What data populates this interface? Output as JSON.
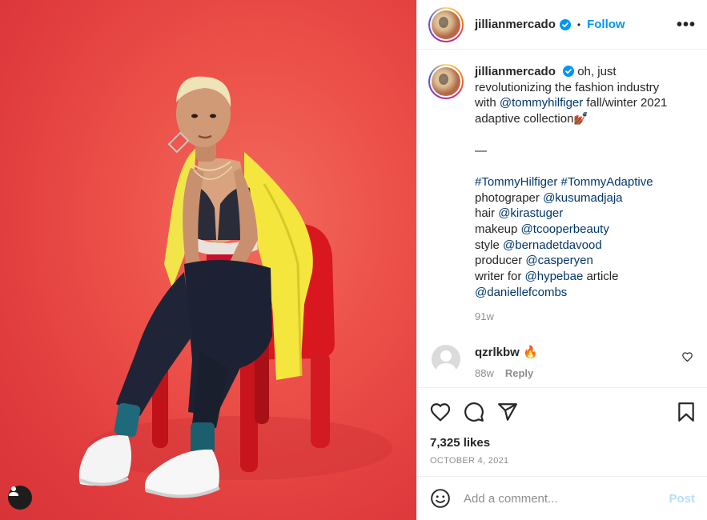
{
  "header": {
    "username": "jillianmercado",
    "separator": "•",
    "follow_label": "Follow",
    "more_label": "•••"
  },
  "caption": {
    "username": "jillianmercado",
    "line1": "oh, just revolutionizing the fashion industry with ",
    "mention_brand": "@tommyhilfiger",
    "line1_tail": " fall/winter 2021 adaptive collection",
    "emoji": "💅🏾",
    "dash": "—",
    "hashtag1": "#TommyHilfiger",
    "hashtag2": "#TommyAdaptive",
    "credits": [
      {
        "role": "photograper ",
        "handle": "@kusumadjaja"
      },
      {
        "role": "hair ",
        "handle": "@kirastuger"
      },
      {
        "role": "makeup ",
        "handle": "@tcooperbeauty"
      },
      {
        "role": "style ",
        "handle": "@bernadetdavood"
      },
      {
        "role": "producer ",
        "handle": "@casperyen"
      },
      {
        "role": "writer for ",
        "handle": "@hypebae"
      }
    ],
    "article_word": " article",
    "last_handle": "@daniellefcombs",
    "time": "91w"
  },
  "comment": {
    "username": "qzrlkbw",
    "text": "🔥",
    "time": "88w",
    "reply_label": "Reply"
  },
  "actions": {
    "likes": "7,325 likes",
    "date": "OCTOBER 4, 2021"
  },
  "add_comment": {
    "placeholder": "Add a comment...",
    "post_label": "Post"
  },
  "colors": {
    "accent": "#0095f6",
    "link": "#00376b",
    "muted": "#8e8e8e",
    "photo_background": "#e5423f"
  },
  "icons": [
    "verified-badge-icon",
    "more-options-icon",
    "heart-icon",
    "comment-icon",
    "share-icon",
    "bookmark-icon",
    "emoji-icon",
    "user-tag-icon",
    "default-avatar-icon"
  ]
}
